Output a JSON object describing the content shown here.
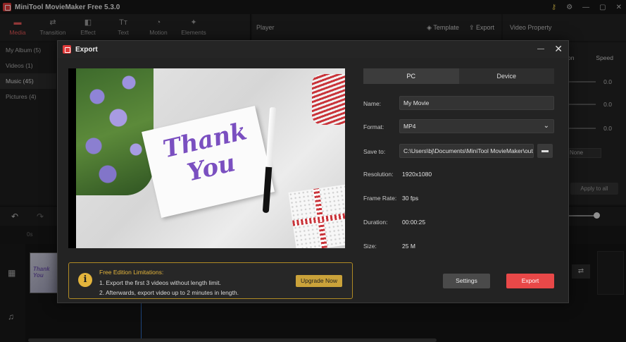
{
  "app": {
    "title": "MiniTool MovieMaker Free 5.3.0",
    "accent": "#e84848"
  },
  "window_controls": [
    {
      "icon": "key-icon",
      "glyph": "⚷"
    },
    {
      "icon": "settings-icon",
      "glyph": "⚙"
    },
    {
      "icon": "minimize-icon",
      "glyph": "—"
    },
    {
      "icon": "maximize-icon",
      "glyph": "▢"
    },
    {
      "icon": "close-icon",
      "glyph": "✕"
    }
  ],
  "toolbar": {
    "items": [
      {
        "label": "Media",
        "glyph": "▬"
      },
      {
        "label": "Transition",
        "glyph": "⇄"
      },
      {
        "label": "Effect",
        "glyph": "◧"
      },
      {
        "label": "Text",
        "glyph": "Tт"
      },
      {
        "label": "Motion",
        "glyph": "◔"
      },
      {
        "label": "Elements",
        "glyph": "✦"
      }
    ]
  },
  "player": {
    "label": "Player",
    "template_label": "Template",
    "export_label": "Export"
  },
  "video_property": {
    "label": "Video Property",
    "tab_partial": "on",
    "tab_speed": "Speed",
    "values": [
      "0.0",
      "0.0",
      "0.0"
    ],
    "none_label": "None",
    "apply_all": "Apply to all"
  },
  "sidebar": {
    "items": [
      {
        "label": "My Album  (5)"
      },
      {
        "label": "Videos  (1)"
      },
      {
        "label": "Music  (45)"
      },
      {
        "label": "Pictures  (4)"
      }
    ]
  },
  "timeline": {
    "ruler_label": "0s"
  },
  "export_dialog": {
    "title": "Export",
    "tabs": [
      {
        "label": "PC"
      },
      {
        "label": "Device"
      }
    ],
    "fields": {
      "name_label": "Name:",
      "name_value": "My Movie",
      "format_label": "Format:",
      "format_value": "MP4",
      "save_label": "Save to:",
      "save_value": "C:\\Users\\bj\\Documents\\MiniTool MovieMaker\\outp",
      "resolution_label": "Resolution:",
      "resolution_value": "1920x1080",
      "framerate_label": "Frame Rate:",
      "framerate_value": "30 fps",
      "duration_label": "Duration:",
      "duration_value": "00:00:25",
      "size_label": "Size:",
      "size_value": "25 M"
    },
    "limitations": {
      "title": "Free Edition Limitations:",
      "line1": "1. Export the first 3 videos without length limit.",
      "line2": "2. Afterwards, export video up to 2 minutes in length.",
      "upgrade_label": "Upgrade Now"
    },
    "settings_label": "Settings",
    "export_label": "Export"
  }
}
